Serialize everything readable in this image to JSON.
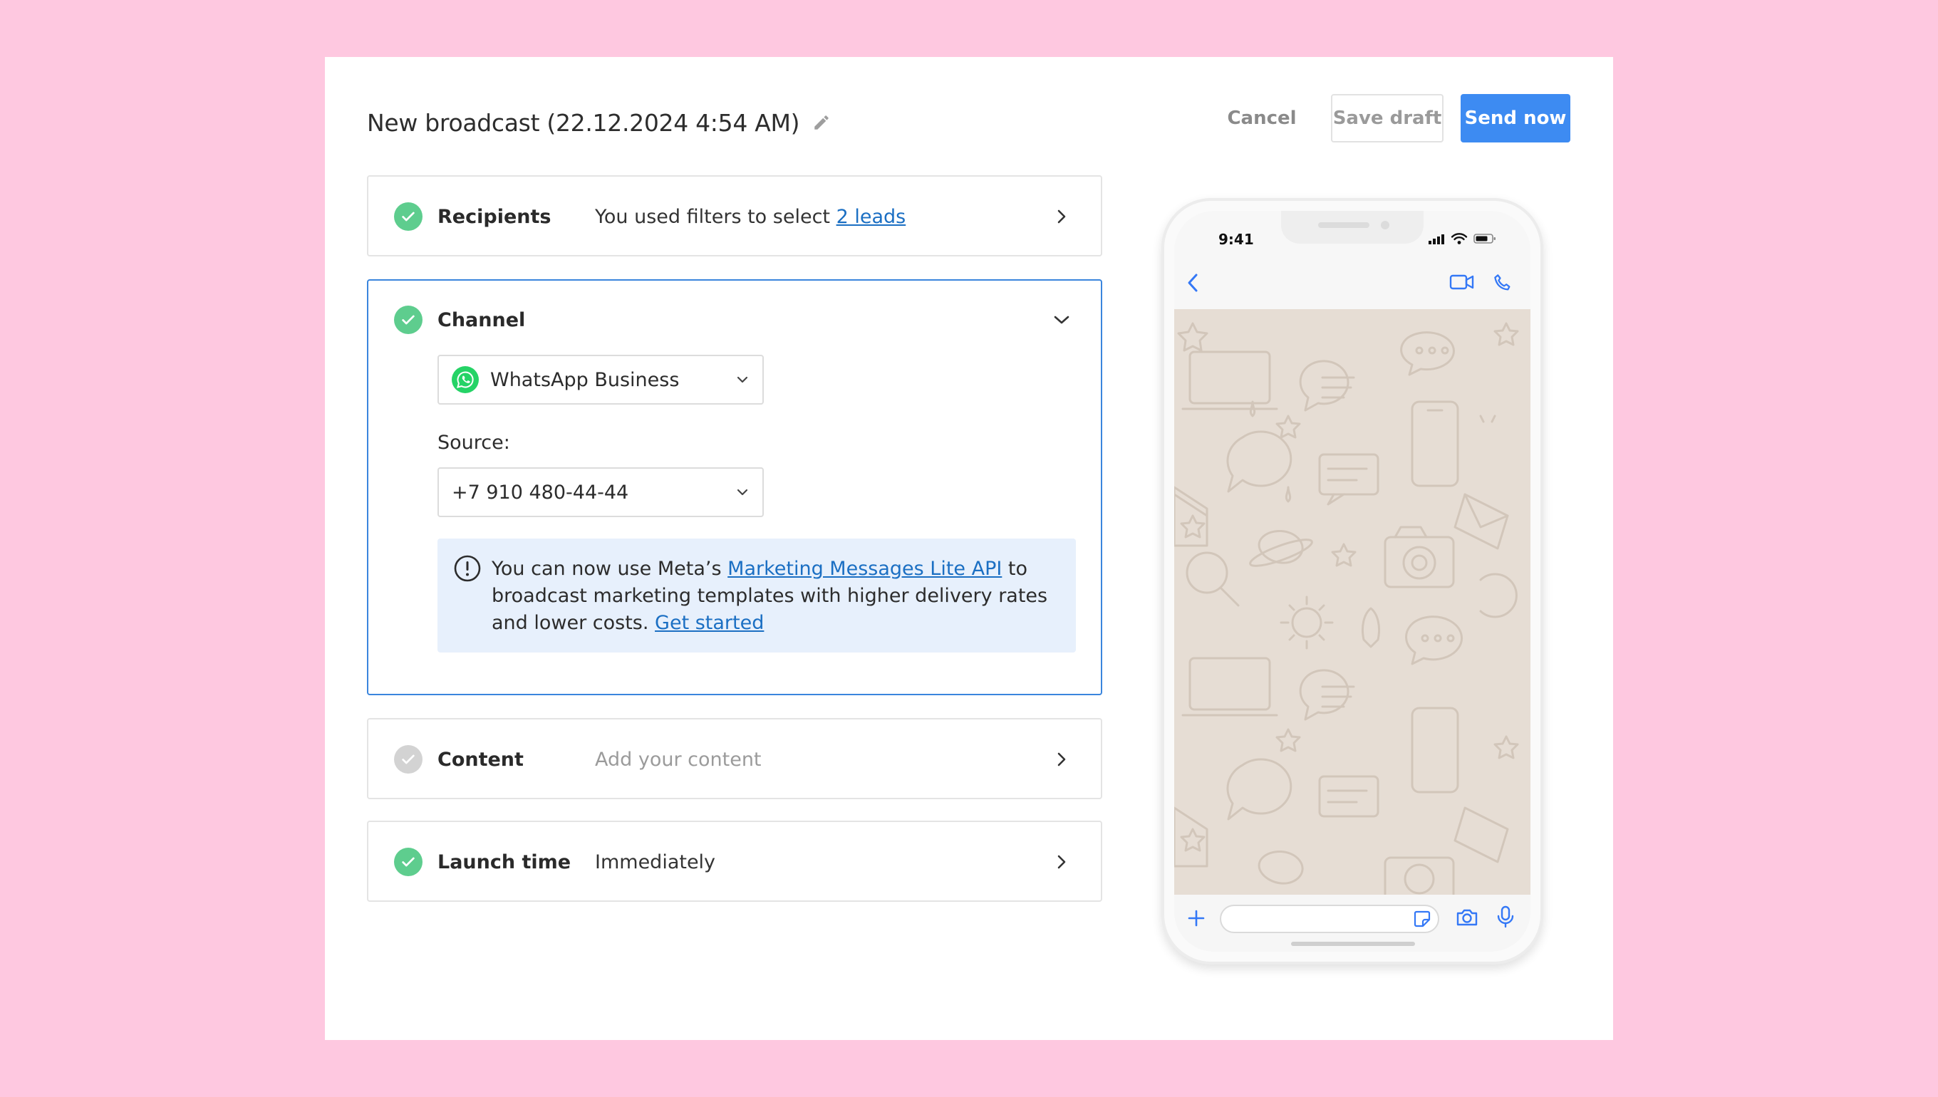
{
  "header": {
    "title": "New broadcast (22.12.2024 4:54 AM)",
    "cancel_label": "Cancel",
    "save_draft_label": "Save draft",
    "send_now_label": "Send now"
  },
  "steps": {
    "recipients": {
      "label": "Recipients",
      "summary_prefix": "You used filters to select ",
      "summary_link": "2 leads"
    },
    "channel": {
      "label": "Channel",
      "channel_value": "WhatsApp Business",
      "source_label": "Source:",
      "source_value": "+7 910 480-44-44",
      "info_prefix": "You can now use Meta’s ",
      "info_link": "Marketing Messages Lite API",
      "info_middle": " to broadcast marketing templates with higher delivery rates and lower costs. ",
      "info_cta": "Get started"
    },
    "content": {
      "label": "Content",
      "summary": "Add your content"
    },
    "launch": {
      "label": "Launch time",
      "summary": "Immediately"
    }
  },
  "phone": {
    "time": "9:41"
  },
  "colors": {
    "accent": "#3d8bf2",
    "success": "#5ecd8e",
    "whatsapp": "#25d366",
    "active_border": "#3a85dd",
    "background": "#fec8e0"
  }
}
